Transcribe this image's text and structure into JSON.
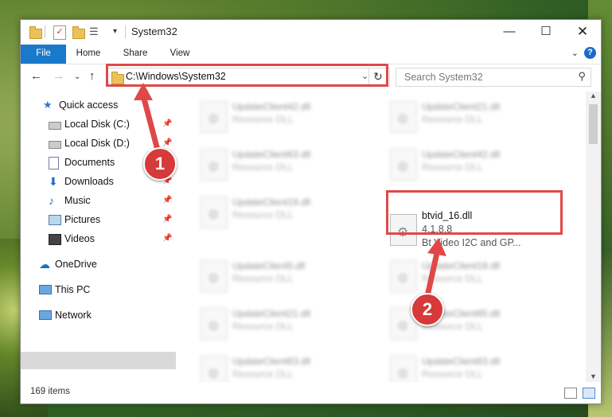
{
  "window": {
    "title": "System32"
  },
  "ribbon": {
    "tabs": [
      "File",
      "Home",
      "Share",
      "View"
    ],
    "help": "?"
  },
  "nav": {
    "address": "C:\\Windows\\System32",
    "search_placeholder": "Search System32"
  },
  "sidebar": {
    "items": [
      {
        "label": "Quick access",
        "icon": "star-icon",
        "pinned": false
      },
      {
        "label": "Local Disk (C:)",
        "icon": "drive-icon",
        "pinned": true
      },
      {
        "label": "Local Disk (D:)",
        "icon": "drive-icon",
        "pinned": true
      },
      {
        "label": "Documents",
        "icon": "document-icon",
        "pinned": true
      },
      {
        "label": "Downloads",
        "icon": "download-icon",
        "pinned": true
      },
      {
        "label": "Music",
        "icon": "music-icon",
        "pinned": true
      },
      {
        "label": "Pictures",
        "icon": "picture-icon",
        "pinned": true
      },
      {
        "label": "Videos",
        "icon": "video-icon",
        "pinned": true
      },
      {
        "label": "OneDrive",
        "icon": "cloud-icon",
        "pinned": false
      },
      {
        "label": "This PC",
        "icon": "pc-icon",
        "pinned": false
      },
      {
        "label": "Network",
        "icon": "network-icon",
        "pinned": false
      }
    ]
  },
  "files": [
    {
      "name": "UpdateClient42.dll",
      "desc": "Resource DLL"
    },
    {
      "name": "UpdateClient21.dll",
      "desc": "Resource DLL"
    },
    {
      "name": "UpdateClient63.dll",
      "desc": "Resource DLL"
    },
    {
      "name": "UpdateClient42.dll",
      "desc": "Resource DLL"
    },
    {
      "name": "UpdateClient19.dll",
      "desc": "Resource DLL"
    },
    {
      "name": "UpdateClient5.dll",
      "desc": "Resource DLL"
    },
    {
      "name": "UpdateClient19.dll",
      "desc": "Resource DLL"
    },
    {
      "name": "UpdateClient21.dll",
      "desc": "Resource DLL"
    },
    {
      "name": "UpdateClient65.dll",
      "desc": "Resource DLL"
    },
    {
      "name": "UpdateClient63.dll",
      "desc": "Resource DLL"
    },
    {
      "name": "UpdateClient63.dll",
      "desc": "Resource DLL"
    }
  ],
  "selected_file": {
    "name": "btvid_16.dll",
    "version": "4.1.8.8",
    "desc": "Bt Video I2C and GP..."
  },
  "status": {
    "items": "169 items"
  },
  "badges": {
    "one": "1",
    "two": "2"
  },
  "colors": {
    "accent": "#1979ca",
    "highlight": "#e04848"
  }
}
